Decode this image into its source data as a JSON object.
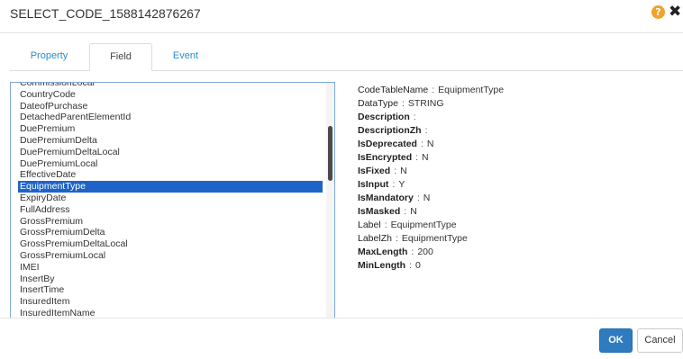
{
  "dialog": {
    "title": "SELECT_CODE_1588142876267",
    "help_icon": "question-circle-icon",
    "close_icon": "close-icon"
  },
  "tabs": [
    {
      "label": "Property",
      "active": false
    },
    {
      "label": "Field",
      "active": true
    },
    {
      "label": "Event",
      "active": false
    }
  ],
  "field_list": {
    "items": [
      "CommissionLocal",
      "CountryCode",
      "DateofPurchase",
      "DetachedParentElementId",
      "DuePremium",
      "DuePremiumDelta",
      "DuePremiumDeltaLocal",
      "DuePremiumLocal",
      "EffectiveDate",
      "EquipmentType",
      "ExpiryDate",
      "FullAddress",
      "GrossPremium",
      "GrossPremiumDelta",
      "GrossPremiumDeltaLocal",
      "GrossPremiumLocal",
      "IMEI",
      "InsertBy",
      "InsertTime",
      "InsuredItem",
      "InsuredItemName"
    ],
    "selected": "EquipmentType",
    "selection_color": "#1e64c8"
  },
  "properties": [
    {
      "key": "CodeTableName",
      "value": "EquipmentType"
    },
    {
      "key": "DataType",
      "value": "STRING"
    },
    {
      "key": "Description",
      "value": ""
    },
    {
      "key": "DescriptionZh",
      "value": ""
    },
    {
      "key": "IsDeprecated",
      "value": "N"
    },
    {
      "key": "IsEncrypted",
      "value": "N"
    },
    {
      "key": "IsFixed",
      "value": "N"
    },
    {
      "key": "IsInput",
      "value": "Y"
    },
    {
      "key": "IsMandatory",
      "value": "N"
    },
    {
      "key": "IsMasked",
      "value": "N"
    },
    {
      "key": "Label",
      "value": "EquipmentType"
    },
    {
      "key": "LabelZh",
      "value": "EquipmentType"
    },
    {
      "key": "MaxLength",
      "value": "200"
    },
    {
      "key": "MinLength",
      "value": "0"
    }
  ],
  "footer": {
    "ok_label": "OK",
    "cancel_label": "Cancel",
    "ok_color": "#2f7bc0"
  }
}
